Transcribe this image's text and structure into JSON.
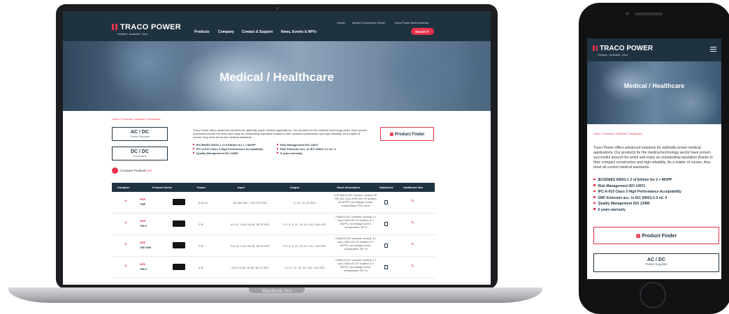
{
  "laptop": {
    "device_label": "MacBook Pro",
    "site": {
      "brand": "TRACO POWER",
      "tagline": "Reliable. Available. Now.",
      "nav": [
        "Products",
        "Company",
        "Contact & Support",
        "News, Events & NPI's"
      ],
      "utility_nav": [
        "Career",
        "Media & Document Center",
        "Traco Power North America"
      ],
      "search_label": "Search",
      "hero_title": "Medical / Healthcare",
      "breadcrumb": "Home / Products / Medical / Healthcare",
      "categories": [
        {
          "title": "AC / DC",
          "subtitle": "Power Supplies"
        },
        {
          "title": "DC / DC",
          "subtitle": "Converters"
        }
      ],
      "intro": "Traco Power offers advanced solutions for optimally power medical applications. Our products for the medical technology sector have proven successful around the world and enjoy an outstanding reputation thanks to their compact construction and high reliability. As a matter of course, they meet all current medical standards.",
      "bullets": [
        "IEC/EN/ES 60601-1 3 rd Edition for 2 × MOPP",
        "IPC-A-610 Class 3 High Performance Acceptability",
        "Quality Management ISO 13485",
        "Risk Management ISO 14971",
        "EMC Emission acc. to IEC 60601-1-2 ed. 4",
        "5 years warranty"
      ],
      "product_finder": "Product Finder",
      "compare_label": "Compare Products",
      "compare_count": "0/4",
      "table": {
        "headers": [
          "Compare",
          "Product Series",
          "Power",
          "Input",
          "Output",
          "Short description",
          "Datasheet",
          "Additional Info"
        ],
        "rows": [
          {
            "badge": "NEW",
            "series": "TMF",
            "power": "5-30 W",
            "input": "80-264 VAC / 120-370 VDC",
            "output": "5, 12, 15, 24 VDC",
            "desc": "5-30 Watt AC/DC modules, medical, 80-264 VAC input, 4000 VAC I/O isolation (2×MOPP), low leakage current, encapsulated, PCB mount"
          },
          {
            "badge": "NEW",
            "series": "TIM 2",
            "power": "2 W",
            "input": "4.5-12, 9-18, 18-36, 36-75 VDC",
            "output": "3.3, 5, 9, 12, 15, 24, ±12, ±15 VDC",
            "desc": "2 Watt DC/DC converter, medical, 2:1 input, 5000 VAC I/O isolation (2 x MOPP), low leakage current, encapsulated, SIP-8"
          },
          {
            "badge": "NEW",
            "series": "TIM 2SM",
            "power": "2 W",
            "input": "4.5-12, 9-18, 18-36, 36-75 VDC",
            "output": "3.3, 5, 9, 12, 15, 24, ±12, ±15 VDC",
            "desc": "2 Watt DC/DC converter, medical, 4:1 input, 5000 VAC I/O isolation (2 x MOPP), low leakage current, encapsulated, SIP-16"
          },
          {
            "badge": "NEW",
            "series": "TIM 3",
            "power": "3 W",
            "input": "4.5-9, 9-18, 18-36, 36-72 VDC",
            "output": "3.3, 5, 12, 15, 24, ±12, ±15 VDC",
            "desc": "3 Watt DC/DC converter, medical, 2:1 input, 5000 VAC I/O isolation (2 x MOPP), low leakage current, encapsulated, DIP-16"
          }
        ]
      }
    }
  },
  "phone": {
    "site": {
      "brand": "TRACO POWER",
      "tagline": "Reliable. Available. Now.",
      "hero_title": "Medical / Healthcare",
      "breadcrumb": "Home / Products / Medical / Healthcare",
      "intro": "Traco Power offers advanced solutions for optimally power medical applications. Our products for the medical technology sector have proven successful around the world and enjoy an outstanding reputation thanks to their compact construction and high reliability. As a matter of course, they meet all current medical standards.",
      "bullets": [
        "IEC/EN/ES 60601-1 3 rd Edition for 2 × MOPP",
        "Risk Management ISO 14971",
        "IPC-A-610 Class 3 High Performance Acceptability",
        "EMC Emission acc. to IEC 60601-1-2 ed. 4",
        "Quality Management ISO 13485",
        "5 years warranty"
      ],
      "product_finder": "Product Finder",
      "category": {
        "title": "AC / DC",
        "subtitle": "Power Supplies"
      }
    }
  },
  "colors": {
    "navy": "#1f3240",
    "brand_red": "#e6324b"
  }
}
